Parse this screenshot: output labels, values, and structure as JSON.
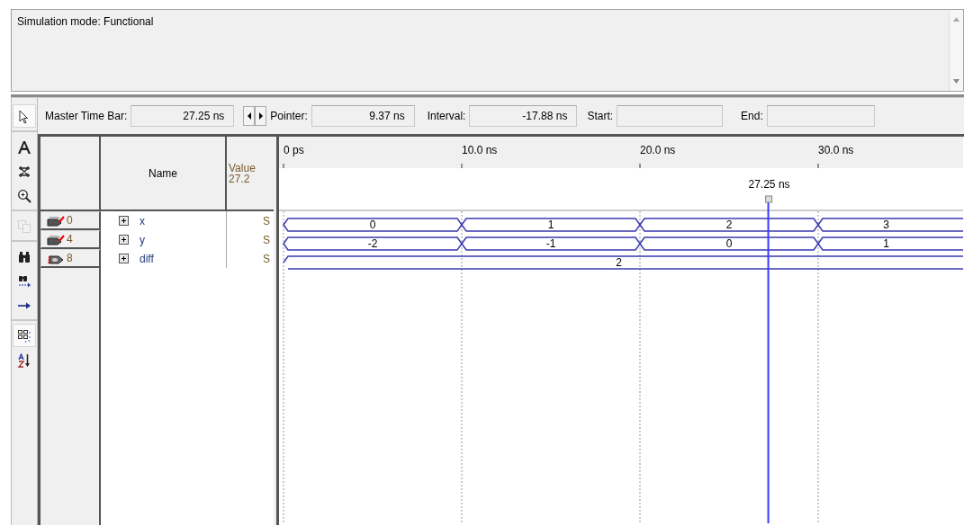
{
  "message_pane": {
    "text": "Simulation mode: Functional"
  },
  "time_bar": {
    "master_label": "Master Time Bar:",
    "master_value": "27.25 ns",
    "pointer_label": "Pointer:",
    "pointer_value": "9.37 ns",
    "interval_label": "Interval:",
    "interval_value": "-17.88 ns",
    "start_label": "Start:",
    "end_label": "End:"
  },
  "tool_groups": [
    [
      {
        "kind": "pointer",
        "selected": true,
        "disabled": false
      }
    ],
    [
      {
        "kind": "text",
        "selected": false,
        "disabled": false
      },
      {
        "kind": "node",
        "selected": false,
        "disabled": false
      },
      {
        "kind": "zoom",
        "selected": false,
        "disabled": false
      }
    ],
    [
      {
        "kind": "copy",
        "selected": false,
        "disabled": true
      }
    ],
    [
      {
        "kind": "find",
        "selected": false,
        "disabled": false
      },
      {
        "kind": "findnext",
        "selected": false,
        "disabled": false
      },
      {
        "kind": "arrow",
        "selected": false,
        "disabled": false
      }
    ],
    [
      {
        "kind": "grid",
        "selected": true,
        "disabled": false
      },
      {
        "kind": "sort",
        "selected": false,
        "disabled": false
      }
    ]
  ],
  "table": {
    "name_header": "Name",
    "value_header": "Value",
    "value_time": "27.2"
  },
  "signals": [
    {
      "index": "0",
      "kind": "input",
      "name": "x",
      "value": "S",
      "cells": [
        {
          "transition": true,
          "value": "0"
        },
        {
          "transition": true,
          "value": "1"
        },
        {
          "transition": true,
          "value": "2"
        },
        {
          "transition": true,
          "value": "3"
        }
      ]
    },
    {
      "index": "4",
      "kind": "input",
      "name": "y",
      "value": "S",
      "cells": [
        {
          "transition": true,
          "value": "-2"
        },
        {
          "transition": true,
          "value": "-1"
        },
        {
          "transition": true,
          "value": "0"
        },
        {
          "transition": true,
          "value": "1"
        }
      ]
    },
    {
      "index": "8",
      "kind": "output",
      "name": "diff",
      "value": "S",
      "cells": [
        {
          "transition": true,
          "value": "2"
        },
        {
          "transition": false
        },
        {
          "transition": false
        },
        {
          "transition": false
        }
      ]
    }
  ],
  "waveform": {
    "ticks": [
      "0 ps",
      "10.0 ns",
      "20.0 ns",
      "30.0 ns"
    ],
    "master_marker": "27.25 ns"
  }
}
